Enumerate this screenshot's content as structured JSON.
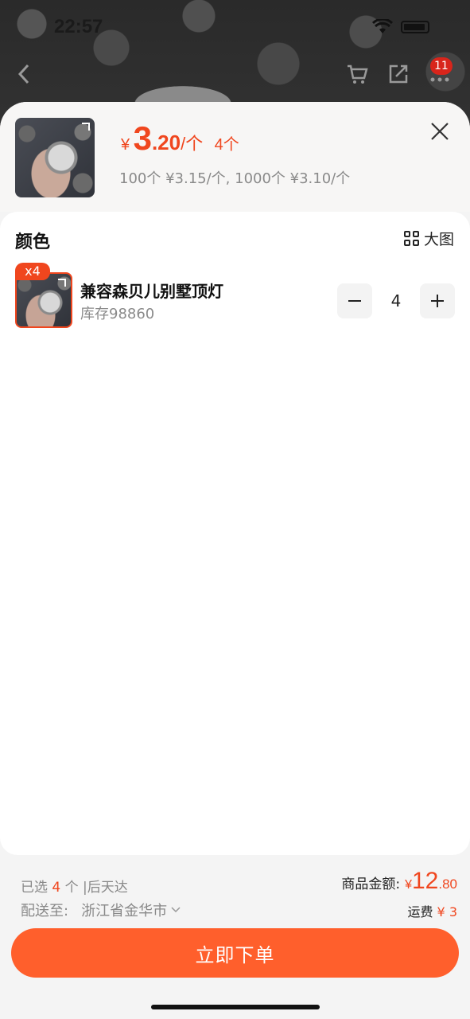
{
  "status": {
    "time": "22:57"
  },
  "nav": {
    "badge_count": "11"
  },
  "product": {
    "price_yen": "¥",
    "price_int": "3",
    "price_dec": ".20",
    "price_unit": "/个",
    "selected_qty": "4个",
    "tier_pricing": "100个 ¥3.15/个, 1000个 ¥3.10/个"
  },
  "options": {
    "section_title": "颜色",
    "big_image_label": "大图",
    "variant": {
      "badge": "x4",
      "name": "兼容森贝儿别墅顶灯",
      "stock": "库存98860",
      "quantity": "4"
    }
  },
  "summary": {
    "selected_prefix": "已选",
    "selected_count": "4",
    "selected_suffix": "个 |后天达",
    "ship_label": "配送至:",
    "ship_location": "浙江省金华市",
    "amount_label": "商品金额:",
    "amount_yen": "¥",
    "amount_int": "12",
    "amount_dec": ".80",
    "freight_label": "运费",
    "freight_value": "¥ 3"
  },
  "actions": {
    "order_button": "立即下单"
  },
  "colors": {
    "accent": "#f0461e",
    "button": "#ff5f2c"
  }
}
